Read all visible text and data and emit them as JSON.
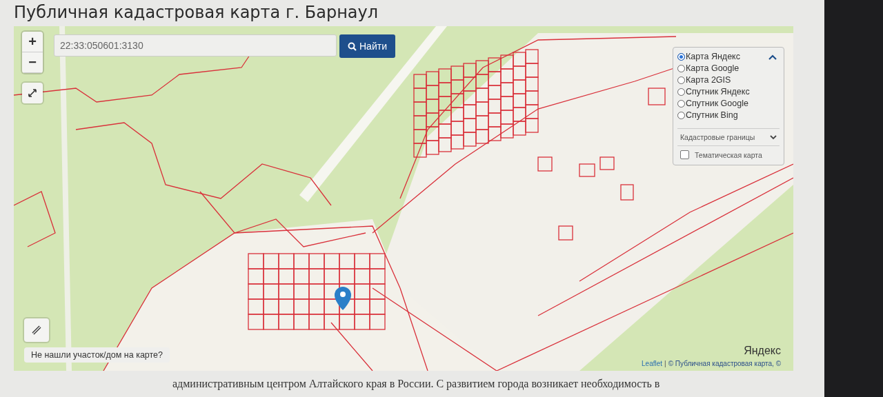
{
  "page": {
    "title": "Публичная кадастровая карта г. Барнаул",
    "paragraph": "административным центром Алтайского края в России. С развитием города возникает необходимость в"
  },
  "map": {
    "zoom_in": "+",
    "zoom_out": "−",
    "search": {
      "value": "22:33:050601:3130"
    },
    "search_button": "Найти",
    "layers": [
      {
        "label": "Карта Яндекс",
        "selected": true
      },
      {
        "label": "Карта Google",
        "selected": false
      },
      {
        "label": "Карта 2GIS",
        "selected": false
      },
      {
        "label": "Спутник Яндекс",
        "selected": false
      },
      {
        "label": "Спутник Google",
        "selected": false
      },
      {
        "label": "Спутник Bing",
        "selected": false
      }
    ],
    "overlay_select": "Кадастровые границы",
    "thematic": {
      "label": "Тематическая карта",
      "checked": false
    },
    "help_link": "Не нашли участок/дом на карте?",
    "provider_logo": "Яндекс",
    "attribution": {
      "link": "Leaflet",
      "separator": "|",
      "text": "© Публичная кадастровая карта, ©"
    }
  }
}
